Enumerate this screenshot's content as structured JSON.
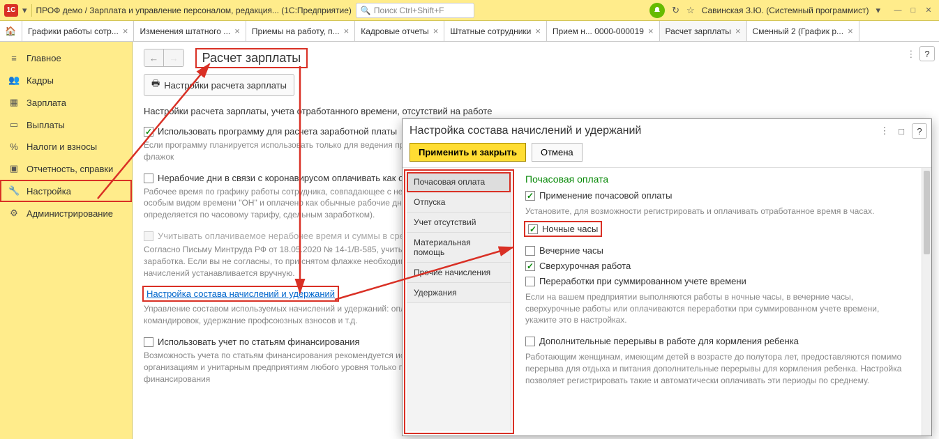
{
  "topbar": {
    "title": "ПРОФ демо / Зарплата и управление персоналом, редакция...  (1С:Предприятие)",
    "search_placeholder": "Поиск Ctrl+Shift+F",
    "username": "Савинская З.Ю. (Системный программист)"
  },
  "tabs": [
    "Графики работы сотр...",
    "Изменения штатного ...",
    "Приемы на работу, п...",
    "Кадровые отчеты",
    "Штатные сотрудники",
    "Прием н... 0000-000019",
    "Расчет зарплаты",
    "Сменный 2 (График р..."
  ],
  "sidebar": {
    "items": [
      {
        "icon": "≡",
        "label": "Главное"
      },
      {
        "icon": "👥",
        "label": "Кадры"
      },
      {
        "icon": "▦",
        "label": "Зарплата"
      },
      {
        "icon": "▭",
        "label": "Выплаты"
      },
      {
        "icon": "%",
        "label": "Налоги и взносы"
      },
      {
        "icon": "▣",
        "label": "Отчетность, справки"
      },
      {
        "icon": "🔧",
        "label": "Настройка"
      },
      {
        "icon": "⚙",
        "label": "Администрирование"
      }
    ]
  },
  "page": {
    "title": "Расчет зарплаты",
    "settings_btn": "Настройки расчета зарплаты",
    "desc": "Настройки расчета зарплаты, учета отработанного времени, отсутствий на работе",
    "chk1": "Использовать программу для расчета заработной платы",
    "help1": "Если программу планируется использовать только для ведения предприятия, снимите этот флажок",
    "chk2": "Нерабочие дни в связи с коронавирусом оплачивать как отработанные",
    "help2": "Рабочее время по графику работы сотрудника, совпадающее с нерабочими днями, отмечается особым видом времени \"ОН\" и оплачено как обычные рабочие дни (оплачиваемость определяется по часовому тарифу, сдельным заработком).",
    "chk3": "Учитывать оплачиваемое нерабочее время и суммы в среднем заработке",
    "help3": "Согласно Письму Минтруда РФ от 18.05.2020 № 14-1/В-585, учитывать при расчете среднего заработка. Если вы не согласны, то при снятом флажке необходимость учета сумм отдельных начислений устанавливается вручную.",
    "link": "Настройка состава начислений и удержаний",
    "help_link": "Управление составом используемых начислений и удержаний: оплата больничных, отпусков, командировок, удержание профсоюзных взносов и т.д.",
    "chk4": "Использовать учет по статьям финансирования",
    "help4": "Возможность учета по статьям финансирования рекомендуется использовать некоммерческим организациям и унитарным предприятиям любого уровня только при наличии целевого финансирования"
  },
  "modal": {
    "title": "Настройка состава начислений и удержаний",
    "apply": "Применить и закрыть",
    "cancel": "Отмена",
    "categories": [
      "Почасовая оплата",
      "Отпуска",
      "Учет отсутствий",
      "Материальная помощь",
      "Прочие начисления",
      "Удержания"
    ],
    "heading": "Почасовая оплата",
    "opt1": "Применение почасовой оплаты",
    "help_opt1": "Установите, для возможности регистрировать и оплачивать отработанное время в часах.",
    "opt2": "Ночные часы",
    "opt3": "Вечерние часы",
    "opt4": "Сверхурочная работа",
    "opt5": "Переработки при суммированном учете времени",
    "help_opt5": "Если на вашем предприятии выполняются работы в ночные часы, в вечерние часы, сверхурочные работы или оплачиваются переработки при суммированном учете времени, укажите это в настройках.",
    "opt6": "Дополнительные перерывы в работе для кормления ребенка",
    "help_opt6": "Работающим женщинам, имеющим детей в возрасте до полутора лет, предоставляются помимо перерыва для отдыха и питания дополнительные перерывы для кормления ребенка. Настройка позволяет регистрировать такие и автоматически оплачивать эти периоды по среднему."
  }
}
